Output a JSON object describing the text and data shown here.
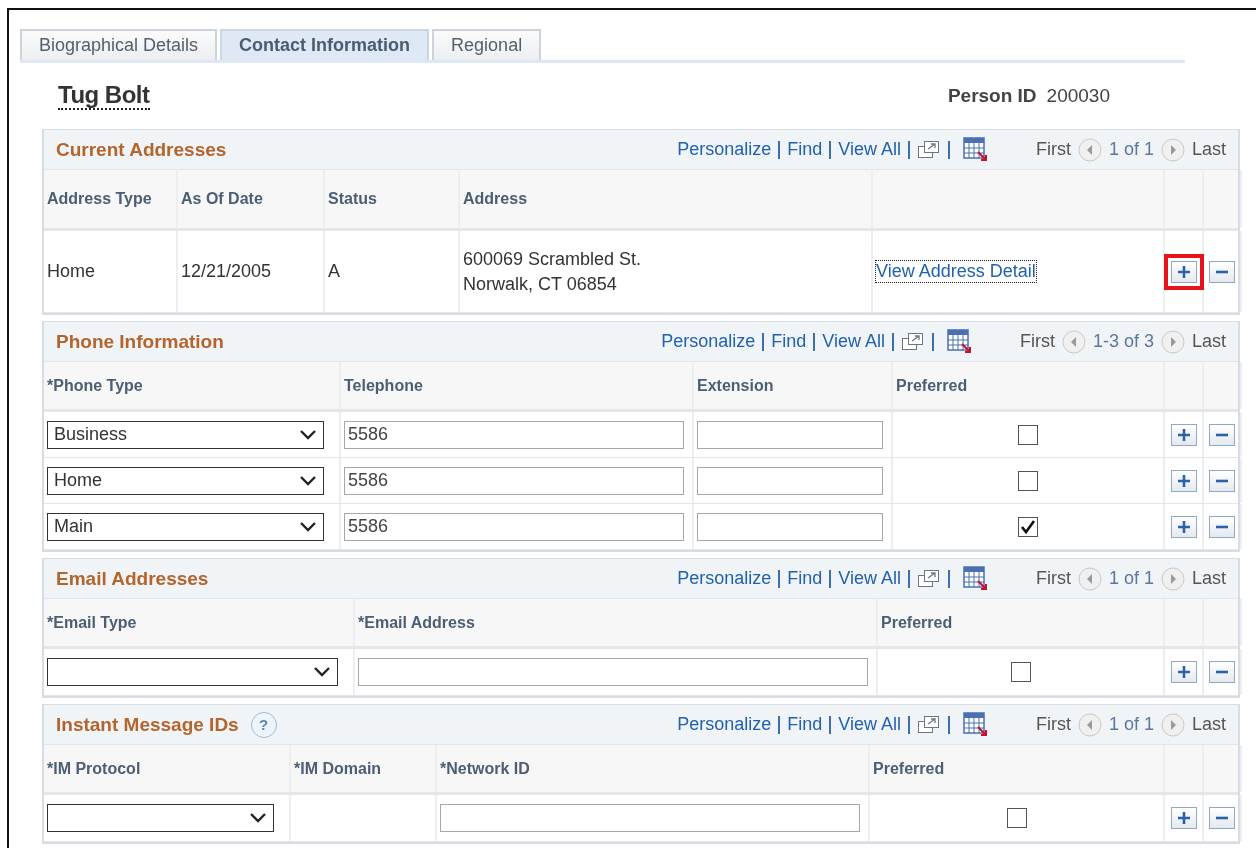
{
  "tabs": [
    {
      "label": "Biographical Details",
      "selected": false
    },
    {
      "label": "Contact Information",
      "selected": true
    },
    {
      "label": "Regional",
      "selected": false
    }
  ],
  "person": {
    "name": "Tug Bolt",
    "id_label": "Person ID",
    "id_value": "200030"
  },
  "grids": [
    {
      "title": "Current Addresses",
      "toolbar": {
        "personalize": "Personalize",
        "find": "Find",
        "view_all": "View All",
        "first": "First",
        "count": "1 of 1",
        "last": "Last"
      },
      "columns": [
        "Address Type",
        "As Of Date",
        "Status",
        "Address"
      ],
      "rows": [
        {
          "add_highlighted": true,
          "cells": [
            {
              "kind": "text",
              "text": "Home"
            },
            {
              "kind": "text",
              "text": "12/21/2005"
            },
            {
              "kind": "text",
              "text": "A"
            },
            {
              "kind": "lines",
              "lines": [
                "600069 Scrambled St.",
                "Norwalk, CT 06854"
              ]
            },
            {
              "kind": "link",
              "text": "View Address Detail"
            }
          ]
        }
      ]
    },
    {
      "title": "Phone Information",
      "toolbar": {
        "personalize": "Personalize",
        "find": "Find",
        "view_all": "View All",
        "first": "First",
        "count": "1-3 of 3",
        "last": "Last"
      },
      "columns": [
        "*Phone Type",
        "Telephone",
        "Extension",
        "Preferred"
      ],
      "rows": [
        {
          "add_highlighted": false,
          "cells": [
            {
              "kind": "select",
              "value": "Business"
            },
            {
              "kind": "input",
              "value": "5586"
            },
            {
              "kind": "input"
            },
            {
              "kind": "checkbox",
              "checked": false
            }
          ]
        },
        {
          "add_highlighted": false,
          "cells": [
            {
              "kind": "select",
              "value": "Home"
            },
            {
              "kind": "input",
              "value": "5586"
            },
            {
              "kind": "input"
            },
            {
              "kind": "checkbox",
              "checked": false
            }
          ]
        },
        {
          "add_highlighted": false,
          "cells": [
            {
              "kind": "select",
              "value": "Main"
            },
            {
              "kind": "input",
              "value": "5586"
            },
            {
              "kind": "input"
            },
            {
              "kind": "checkbox",
              "checked": true
            }
          ]
        }
      ]
    },
    {
      "title": "Email Addresses",
      "toolbar": {
        "personalize": "Personalize",
        "find": "Find",
        "view_all": "View All",
        "first": "First",
        "count": "1 of 1",
        "last": "Last"
      },
      "columns": [
        "*Email Type",
        "*Email Address",
        "Preferred"
      ],
      "rows": [
        {
          "add_highlighted": false,
          "cells": [
            {
              "kind": "select"
            },
            {
              "kind": "input"
            },
            {
              "kind": "checkbox",
              "checked": false
            }
          ]
        }
      ]
    },
    {
      "title": "Instant Message IDs",
      "help_icon": "?",
      "toolbar": {
        "personalize": "Personalize",
        "find": "Find",
        "view_all": "View All",
        "first": "First",
        "count": "1 of 1",
        "last": "Last"
      },
      "columns": [
        "*IM Protocol",
        "*IM Domain",
        "*Network ID",
        "Preferred"
      ],
      "rows": [
        {
          "add_highlighted": false,
          "cells": [
            {
              "kind": "select"
            },
            {
              "kind": "empty"
            },
            {
              "kind": "input"
            },
            {
              "kind": "checkbox",
              "checked": false
            }
          ]
        }
      ]
    }
  ]
}
